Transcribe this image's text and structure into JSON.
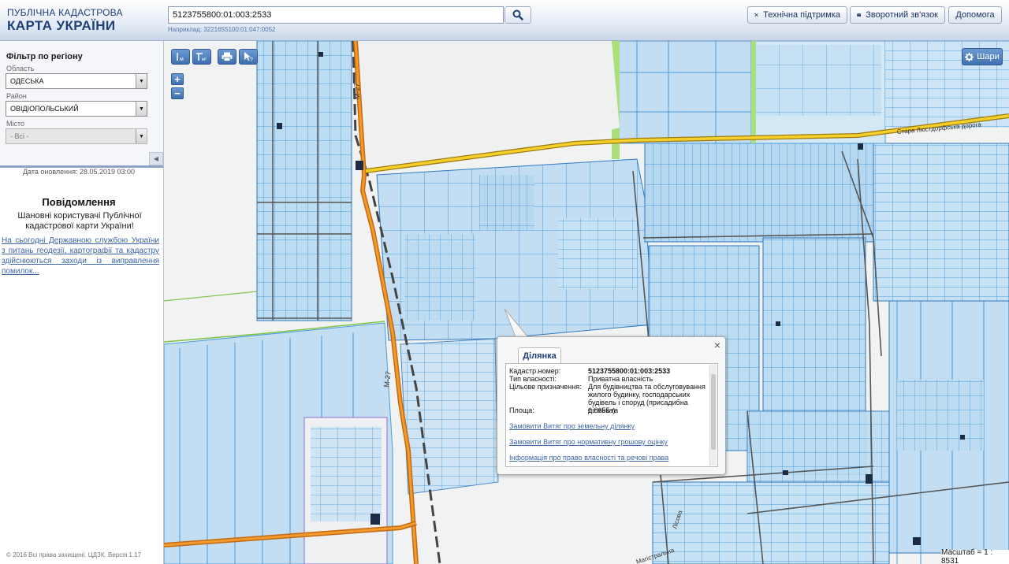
{
  "header": {
    "logo_line1": "ПУБЛІЧНА КАДАСТРОВА",
    "logo_line2": "КАРТА УКРАЇНИ",
    "search_value": "5123755800:01:003:2533",
    "search_hint": "Наприклад: 3221655100:01:047:0052",
    "search_icon": "search-icon",
    "buttons": [
      {
        "label": "Технічна підтримка",
        "icon": "wrench-icon"
      },
      {
        "label": "Зворотний зв'язок",
        "icon": "envelope-icon"
      },
      {
        "label": "Допомога"
      }
    ]
  },
  "sidebar": {
    "filter_title": "Фільтр по регіону",
    "oblast_label": "Область",
    "oblast_value": "ОДЕСЬКА",
    "raion_label": "Район",
    "raion_value": "ОВІДІОПОЛЬСЬКИЙ",
    "misto_label": "Місто",
    "misto_value": "- Всі -",
    "update_date": "Дата оновлення: 28.05.2019 03:00",
    "message_title": "Повідомлення",
    "message_body": "Шановні користувачі Публічної кадастрової карти України!",
    "message_link": "На сьогодні Державною службою України з питань геодезії, картографії та кадастру здійснюються заходи із виправлення помилок...",
    "copyright": "© 2016 Всі права захищені. ЦДЗК. Версія 1.17"
  },
  "map": {
    "layers_label": "Шари",
    "scale_text": "Масштаб = 1 : 8531",
    "road_labels": [
      "М-27",
      "М-27",
      "Стара Люстдорфська дорога",
      "Магістральна",
      "Лісова"
    ],
    "accent_color": "#3f6fae",
    "parcel_color": "#bcdcf2",
    "parcel_stroke": "#4a9bd8",
    "road_color": "#e8a12b"
  },
  "popup": {
    "tab_label": "Ділянка",
    "rows": [
      {
        "label": "Кадастр.номер:",
        "value": "5123755800:01:003:2533"
      },
      {
        "label": "Тип власності:",
        "value": "Приватна власність"
      },
      {
        "label": "Цільове призначення:",
        "value": "Для будівництва та обслуговування жилого будинку, господарських будівель і споруд (присадибна ділянка)"
      },
      {
        "label": "Площа:",
        "value": "0.0655 га"
      }
    ],
    "links": [
      "Замовити Витяг про земельну ділянку",
      "Замовити Витяг про нормативну грошову оцінку",
      "Інформація про право власності та речові права"
    ]
  }
}
